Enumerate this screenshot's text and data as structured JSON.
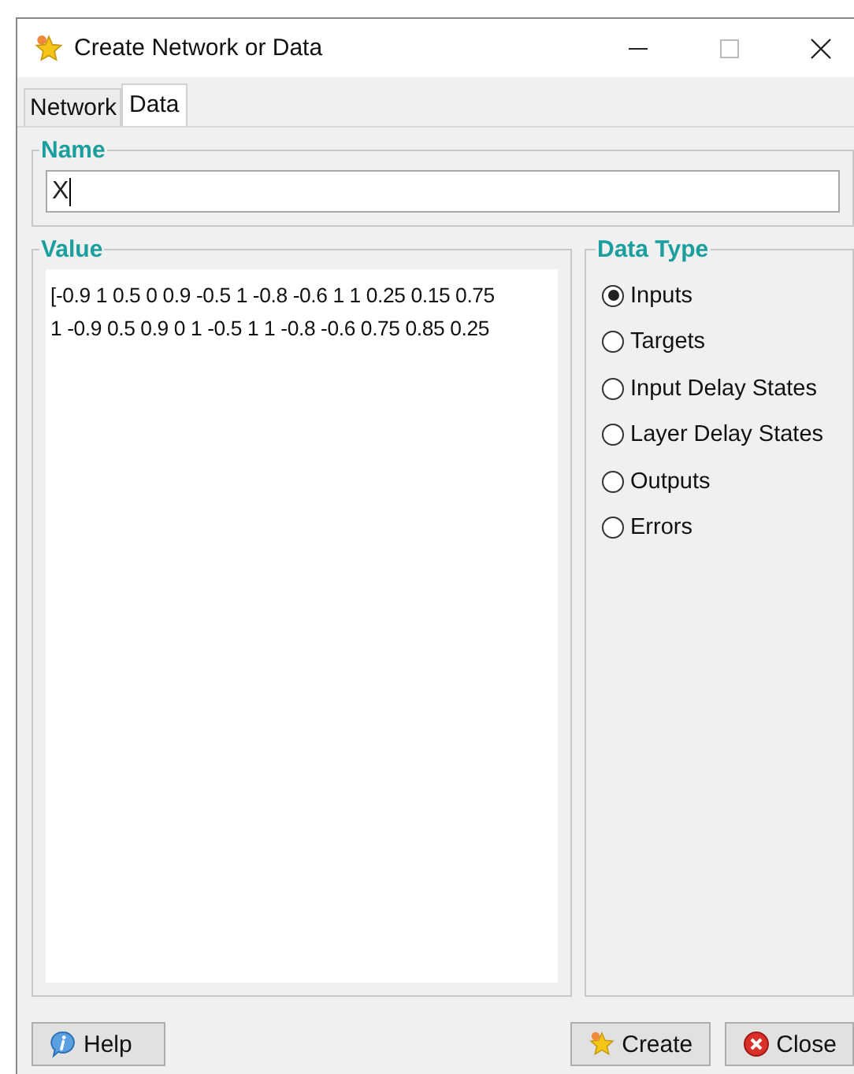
{
  "window": {
    "title": "Create Network or Data"
  },
  "tabs": [
    {
      "label": "Network",
      "selected": false
    },
    {
      "label": "Data",
      "selected": true
    }
  ],
  "name_group": {
    "title": "Name",
    "value": "X"
  },
  "value_group": {
    "title": "Value",
    "lines": [
      "[-0.9 1 0.5 0 0.9 -0.5 1 -0.8 -0.6 1 1 0.25 0.15 0.75",
      "1 -0.9 0.5 0.9 0 1 -0.5 1 1 -0.8 -0.6 0.75 0.85 0.25"
    ]
  },
  "data_type": {
    "title": "Data Type",
    "options": [
      {
        "label": "Inputs",
        "selected": true
      },
      {
        "label": "Targets",
        "selected": false
      },
      {
        "label": "Input Delay States",
        "selected": false
      },
      {
        "label": "Layer Delay States",
        "selected": false
      },
      {
        "label": "Outputs",
        "selected": false
      },
      {
        "label": "Errors",
        "selected": false
      }
    ]
  },
  "buttons": [
    {
      "label": "Help",
      "kind": "help"
    },
    {
      "label": "Create",
      "kind": "create"
    },
    {
      "label": "Close",
      "kind": "close"
    }
  ]
}
